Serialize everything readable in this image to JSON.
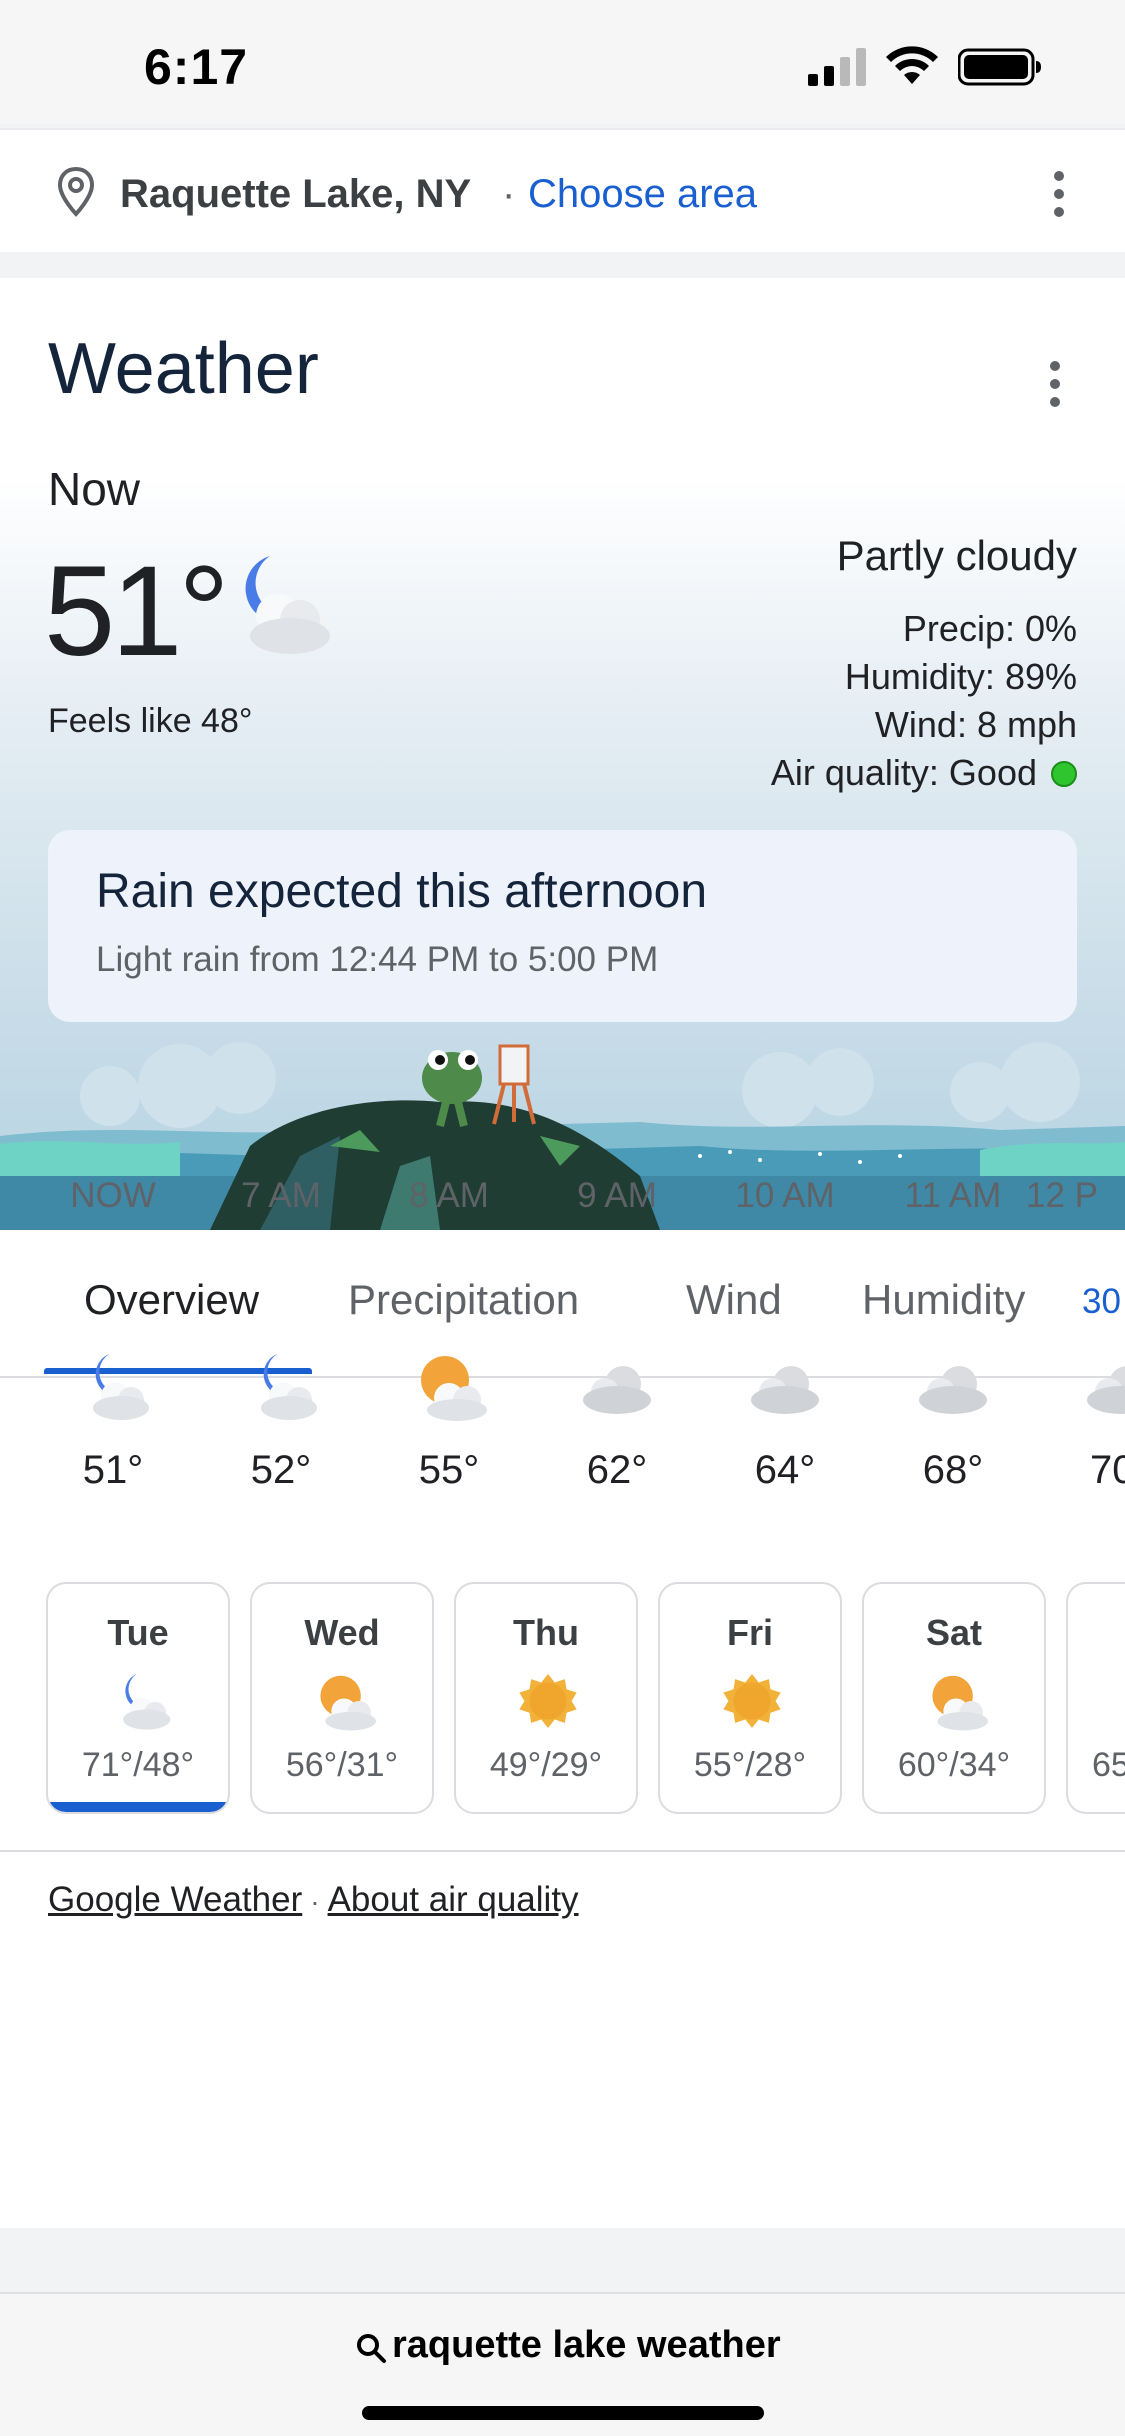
{
  "status_bar": {
    "time": "6:17"
  },
  "location": {
    "name": "Raquette Lake, NY",
    "separator": "·",
    "choose_label": "Choose area"
  },
  "weather": {
    "title": "Weather",
    "now_label": "Now",
    "temperature": "51°",
    "feels_like": "Feels like 48°",
    "condition": "Partly cloudy",
    "precip": "Precip: 0%",
    "humidity": "Humidity: 89%",
    "wind": "Wind: 8 mph",
    "air_quality": "Air quality: Good",
    "alert": {
      "title": "Rain expected this afternoon",
      "subtitle": "Light rain from 12:44 PM to 5:00 PM"
    }
  },
  "tabs": [
    {
      "label": "Overview",
      "active": true
    },
    {
      "label": "Precipitation"
    },
    {
      "label": "Wind"
    },
    {
      "label": "Humidity"
    }
  ],
  "hourly": [
    {
      "time": "NOW",
      "icon": "moon-cloud-icon",
      "temp": "51°"
    },
    {
      "time": "7 AM",
      "icon": "moon-cloud-icon",
      "temp": "52°"
    },
    {
      "time": "8 AM",
      "icon": "sun-cloud-icon",
      "temp": "55°"
    },
    {
      "time": "9 AM",
      "icon": "cloud-icon",
      "temp": "62°"
    },
    {
      "time": "10 AM",
      "icon": "cloud-icon",
      "temp": "64°"
    },
    {
      "time": "11 AM",
      "icon": "cloud-icon",
      "temp": "68°"
    },
    {
      "time": "12 P",
      "icon": "cloud-icon",
      "temp": "70",
      "precip": "30"
    }
  ],
  "daily": [
    {
      "day": "Tue",
      "icon": "moon-cloud-icon",
      "temps": "71°/48°",
      "selected": true
    },
    {
      "day": "Wed",
      "icon": "sun-cloud-icon",
      "temps": "56°/31°"
    },
    {
      "day": "Thu",
      "icon": "sun-icon",
      "temps": "49°/29°"
    },
    {
      "day": "Fri",
      "icon": "sun-icon",
      "temps": "55°/28°"
    },
    {
      "day": "Sat",
      "icon": "sun-cloud-icon",
      "temps": "60°/34°"
    },
    {
      "day": "",
      "icon": "",
      "temps": "65"
    }
  ],
  "footer": {
    "source_link": "Google Weather",
    "separator": "·",
    "air_quality_link": "About air quality"
  },
  "search": {
    "query": "raquette lake weather"
  },
  "colors": {
    "accent": "#1a5fd0",
    "air_quality_good": "#2fc52f"
  }
}
